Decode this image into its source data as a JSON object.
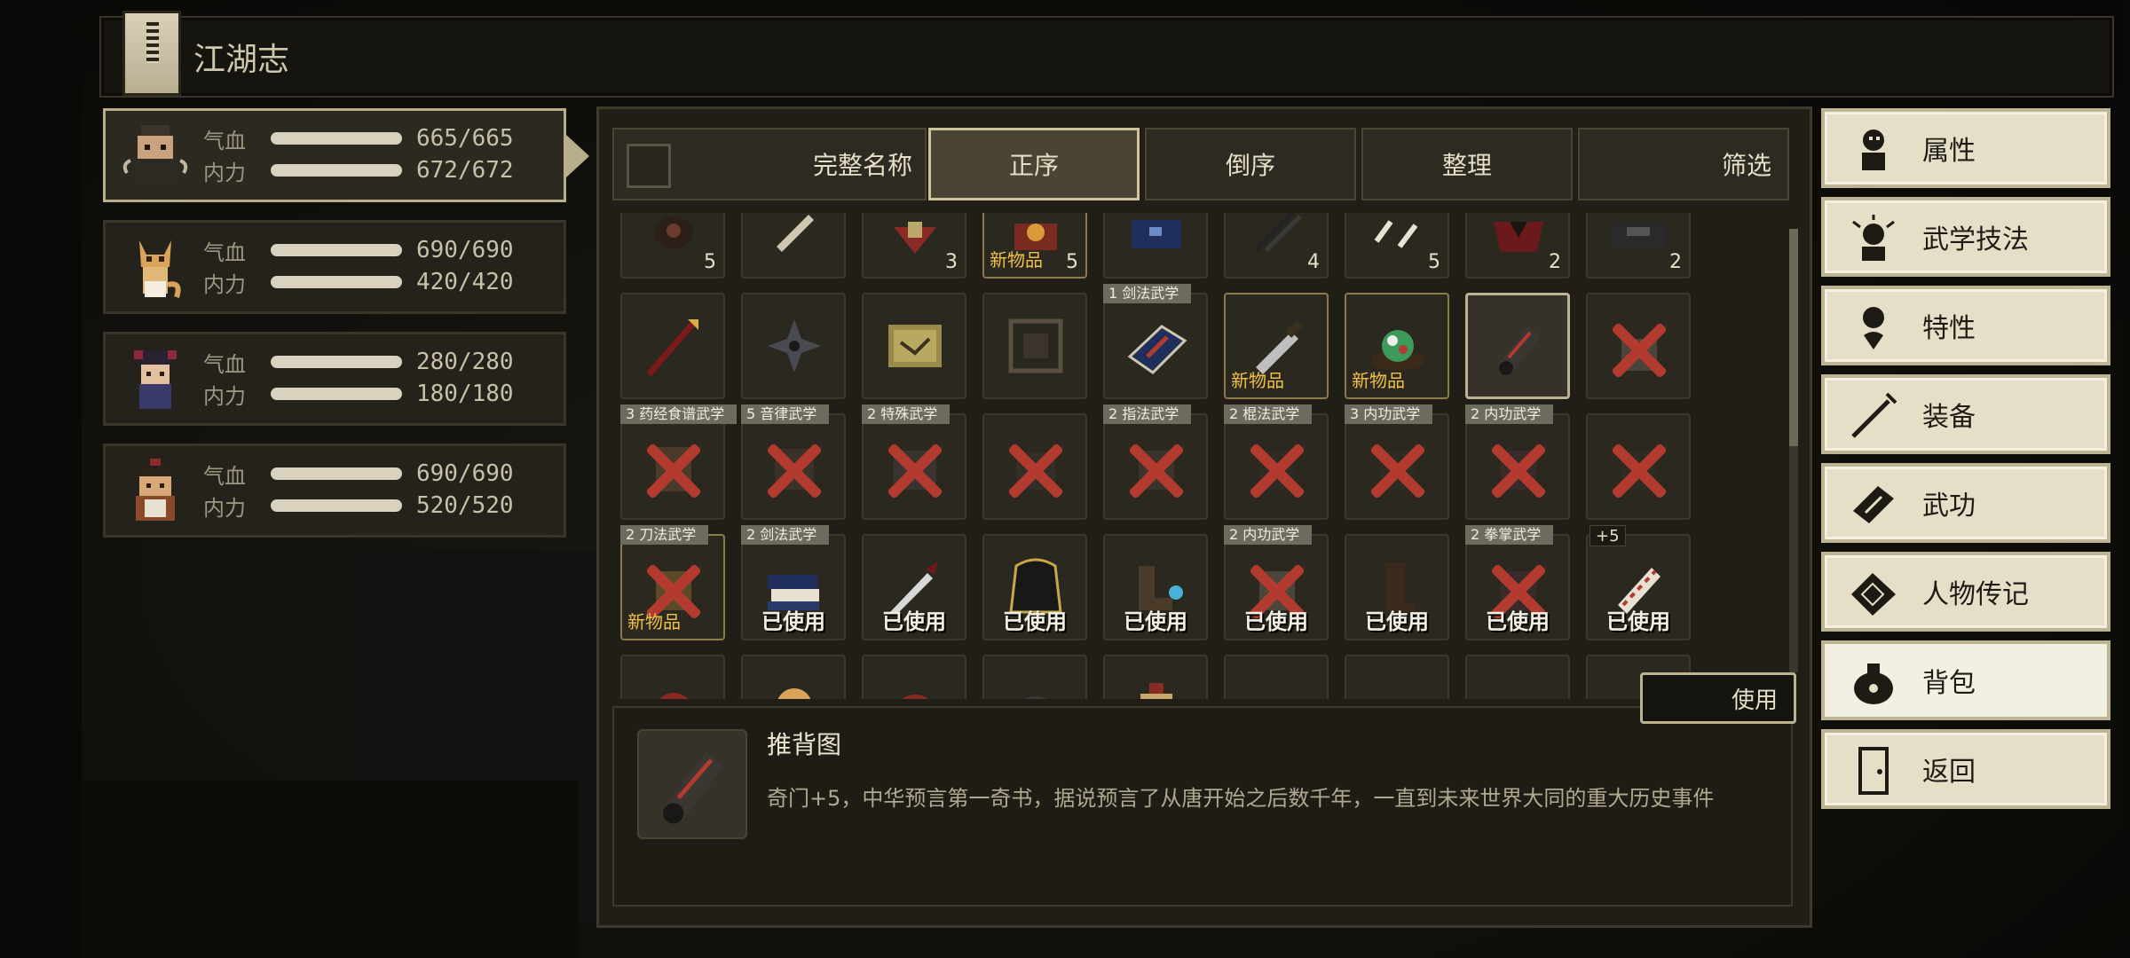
{
  "title": "江湖志",
  "party": [
    {
      "hp_label": "气血",
      "hp": "665/665",
      "mp_label": "内力",
      "mp": "672/672",
      "hp_fill": 1.0,
      "mp_fill": 1.0
    },
    {
      "hp_label": "气血",
      "hp": "690/690",
      "mp_label": "内力",
      "mp": "420/420",
      "hp_fill": 1.0,
      "mp_fill": 1.0
    },
    {
      "hp_label": "气血",
      "hp": "280/280",
      "mp_label": "内力",
      "mp": "180/180",
      "hp_fill": 1.0,
      "mp_fill": 1.0
    },
    {
      "hp_label": "气血",
      "hp": "690/690",
      "mp_label": "内力",
      "mp": "520/520",
      "hp_fill": 1.0,
      "mp_fill": 1.0
    }
  ],
  "tabs": {
    "fullname": "完整名称",
    "asc": "正序",
    "desc": "倒序",
    "sort": "整理",
    "filter": "筛选"
  },
  "labels": {
    "new_item": "新物品",
    "used": "已使用",
    "use_button": "使用"
  },
  "inventory": {
    "row0": [
      {
        "count": "5"
      },
      {
        "count": ""
      },
      {
        "count": "3"
      },
      {
        "count": "5",
        "new": true
      },
      {
        "count": ""
      },
      {
        "count": "4"
      },
      {
        "count": "5"
      },
      {
        "count": "2"
      },
      {
        "count": "2"
      }
    ],
    "banners": {
      "r1c4": "1 剑法武学",
      "r2c0": "3 药经食谱武学",
      "r2c1": "5 音律武学",
      "r2c2": "2 特殊武学",
      "r2c4": "2 指法武学",
      "r2c5": "2 棍法武学",
      "r2c6": "3 内功武学",
      "r2c7": "2 内功武学",
      "r3c0": "2 刀法武学",
      "r3c1": "2 剑法武学",
      "r3c5": "2 内功武学",
      "r3c7": "2 拳掌武学",
      "r3c8": "+5"
    }
  },
  "detail": {
    "name": "推背图",
    "description": "奇门+5，中华预言第一奇书，据说预言了从唐开始之后数千年，一直到未来世界大同的重大历史事件"
  },
  "menu": [
    {
      "label": "属性",
      "icon": "attributes-icon"
    },
    {
      "label": "武学技法",
      "icon": "martial-skills-icon"
    },
    {
      "label": "特性",
      "icon": "traits-icon"
    },
    {
      "label": "装备",
      "icon": "equipment-icon"
    },
    {
      "label": "武功",
      "icon": "kungfu-book-icon"
    },
    {
      "label": "人物传记",
      "icon": "biography-icon"
    },
    {
      "label": "背包",
      "icon": "bag-icon"
    },
    {
      "label": "返回",
      "icon": "door-icon"
    }
  ],
  "colors": {
    "accent_red": "#b33a2e",
    "panel_bg": "#211e18",
    "menu_bg": "#e6dfc7",
    "new_item": "#f0c24a"
  }
}
